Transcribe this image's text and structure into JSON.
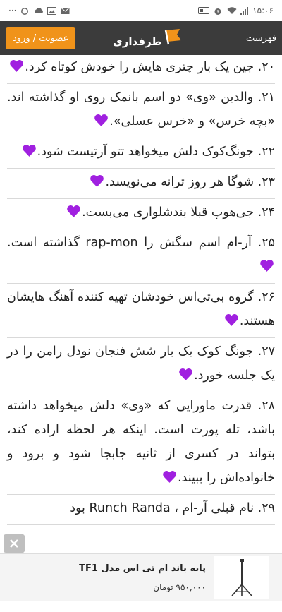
{
  "status_bar": {
    "time": "۱۵:۰۶",
    "more": "···"
  },
  "header": {
    "login_button": "عضویت / ورود",
    "logo_text": "طرفداری",
    "menu_label": "فهرست"
  },
  "items": [
    {
      "text": "۲۰. جین یک بار چتری هایش را خودش کوتاه کرد."
    },
    {
      "text": "۲۱. والدین «وی» دو اسم بانمک روی او گذاشته اند. «بچه خرس» و «خرس عسلی»."
    },
    {
      "text": "۲۲. جونگ‌کوک دلش میخواهد تتو آرتیست شود."
    },
    {
      "text": "۲۳. شوگا هر روز ترانه می‌نویسد."
    },
    {
      "text": "۲۴. جی‌هوپ قبلا بندشلواری می‌بست."
    },
    {
      "text": "۲۵. آر-ام اسم سگش را rap-mon گذاشته است."
    },
    {
      "text": "۲۶. گروه بی‌تی‌اس خودشان تهیه کننده آهنگ هایشان هستند."
    },
    {
      "text": "۲۷. جونگ کوک یک بار شش فنجان نودل رامن را در یک جلسه خورد."
    },
    {
      "text": "۲۸. قدرت ماورایی که «وی» دلش میخواهد داشته باشد، تله پورت است. اینکه هر لحظه اراده کند، بتواند در کسری از ثانیه جابجا شود و برود و خانواده‌اش را ببیند."
    },
    {
      "text": "۲۹. نام قبلی آر-ام ، Runch Randa بود"
    }
  ],
  "ad": {
    "title": "پایه باند ام تی اس مدل TF1",
    "price": "۹۵۰,۰۰۰ تومان"
  },
  "colors": {
    "header_bg": "#3b3b3b",
    "accent": "#f0931a",
    "heart": "#a020e0"
  }
}
